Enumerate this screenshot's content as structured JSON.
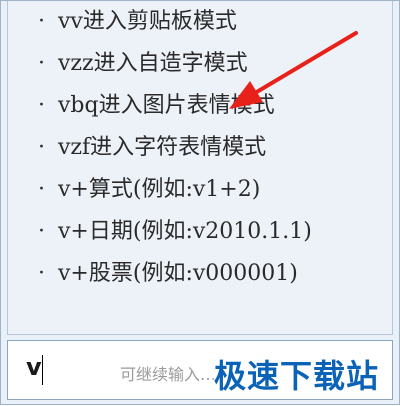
{
  "commands": [
    {
      "label": "vv进入剪贴板模式"
    },
    {
      "label": "vzz进入自造字模式"
    },
    {
      "label": "vbq进入图片表情模式"
    },
    {
      "label": "vzf进入字符表情模式"
    },
    {
      "label": "v+算式(例如:v1+2)"
    },
    {
      "label": "v+日期(例如:v2010.1.1)"
    },
    {
      "label": "v+股票(例如:v000001)"
    }
  ],
  "bullet": "·",
  "input": {
    "value": "v",
    "hint": "可继续输入…"
  },
  "watermark": "极速下载站",
  "colors": {
    "arrow": "#e8221b",
    "panel_bg": "#edf2f8",
    "watermark": "#0b63b8"
  }
}
